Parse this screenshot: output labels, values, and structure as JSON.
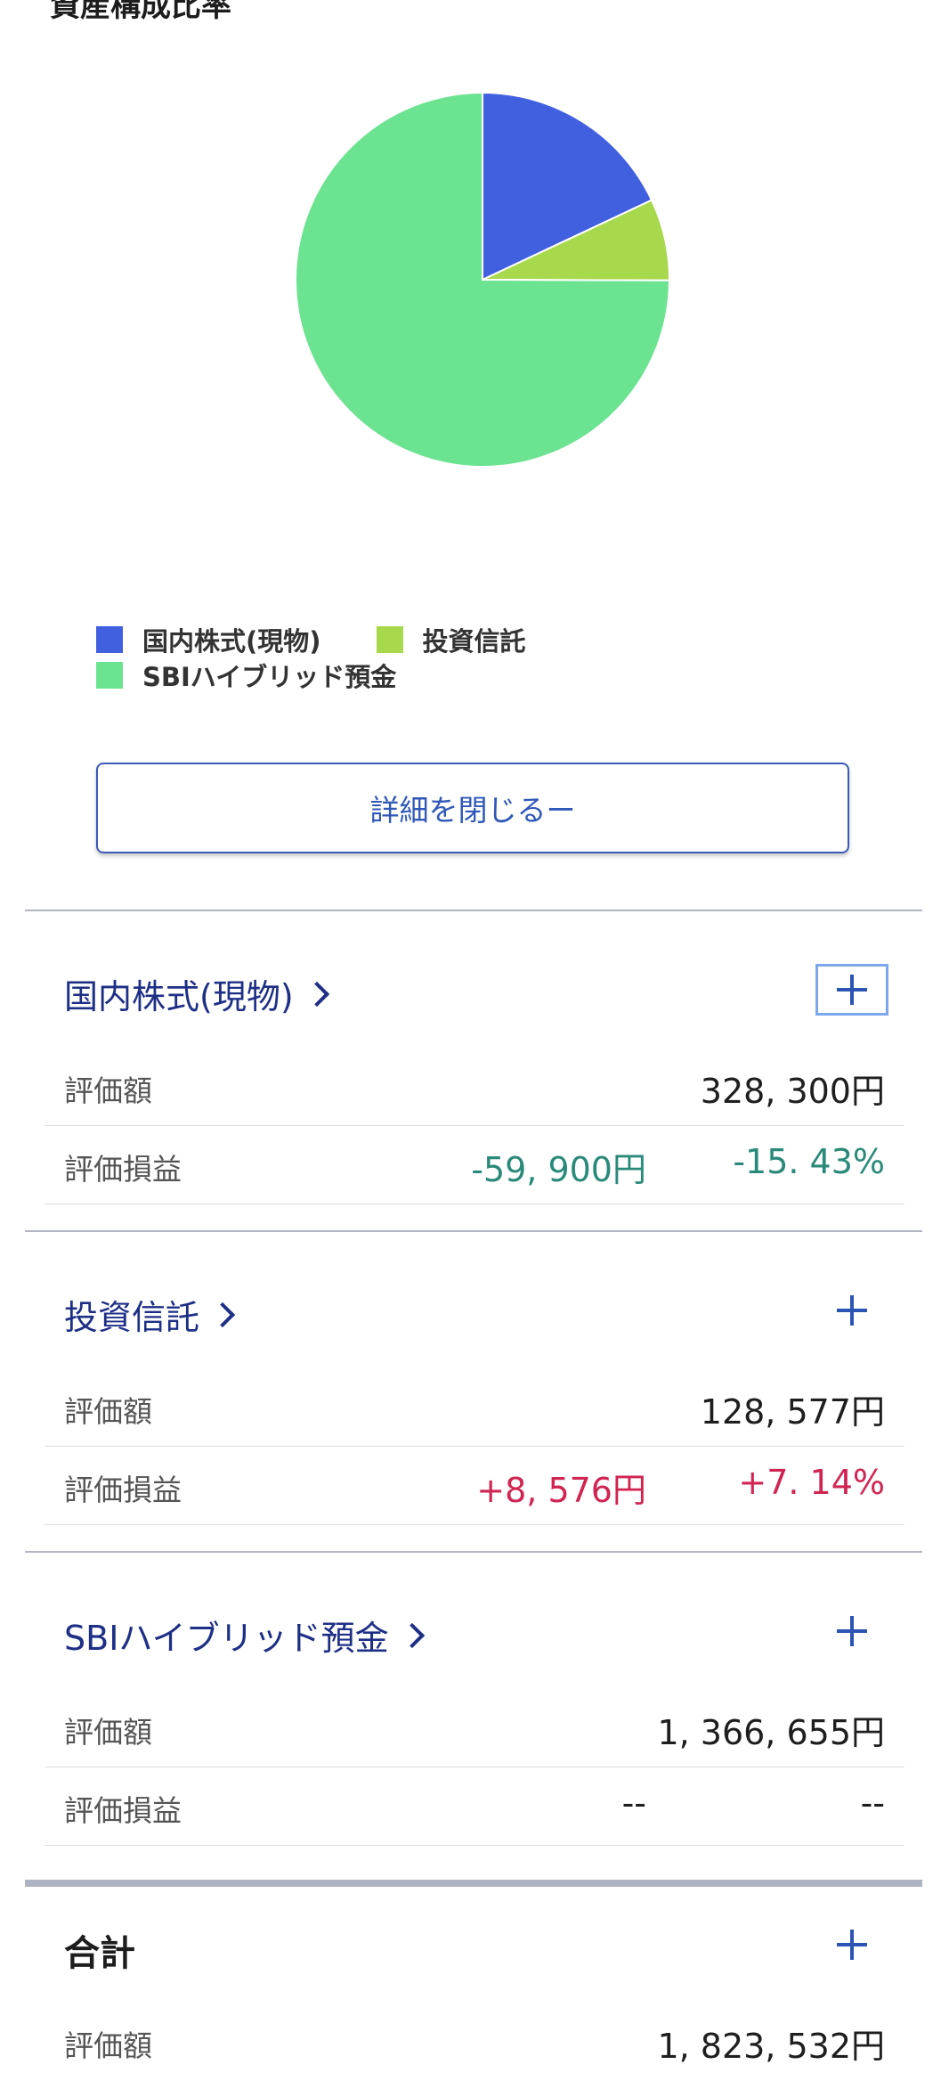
{
  "section_title": "資産構成比率",
  "chart_data": {
    "type": "pie",
    "slices": [
      {
        "label": "国内株式(現物)",
        "value": 328300,
        "color": "#4060E0"
      },
      {
        "label": "投資信託",
        "value": 128577,
        "color": "#A8D84C"
      },
      {
        "label": "SBIハイブリッド預金",
        "value": 1366655,
        "color": "#6CE391"
      }
    ],
    "legend_placement": "bottom-left"
  },
  "close_button_label": "詳細を閉じるー",
  "categories": [
    {
      "title": "国内株式(現物)",
      "rows": [
        {
          "label": "評価額",
          "value": "328, 300円"
        },
        {
          "label": "評価損益",
          "amount": "-59, 900円",
          "percent": "-15. 43%",
          "sign": "negative"
        }
      ]
    },
    {
      "title": "投資信託",
      "rows": [
        {
          "label": "評価額",
          "value": "128, 577円"
        },
        {
          "label": "評価損益",
          "amount": "+8, 576円",
          "percent": "+7. 14%",
          "sign": "positive"
        }
      ]
    },
    {
      "title": "SBIハイブリッド預金",
      "rows": [
        {
          "label": "評価額",
          "value": "1, 366, 655円"
        },
        {
          "label": "評価損益",
          "amount": "--",
          "percent": "--",
          "sign": "neutral"
        }
      ]
    }
  ],
  "total": {
    "title": "合計",
    "rows": [
      {
        "label": "評価額",
        "value": "1, 823, 532円"
      }
    ]
  },
  "colors": {
    "accent": "#2B54B4",
    "negative": "#2A8A7A",
    "positive": "#D02452"
  }
}
